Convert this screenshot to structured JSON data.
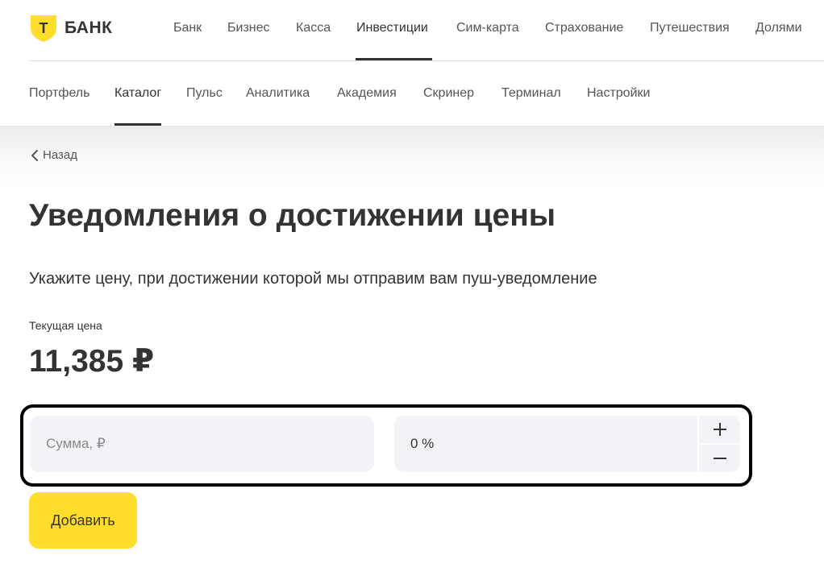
{
  "logo": {
    "text": "БАНК",
    "letter": "T",
    "color": "#ffdd2d"
  },
  "top_nav": {
    "items": [
      "Банк",
      "Бизнес",
      "Касса",
      "Инвестиции",
      "Сим-карта",
      "Страхование",
      "Путешествия",
      "Долями"
    ],
    "active": "Инвестиции"
  },
  "sub_nav": {
    "items": [
      "Портфель",
      "Каталог",
      "Пульс",
      "Аналитика",
      "Академия",
      "Скринер",
      "Терминал",
      "Настройки"
    ],
    "active": "Каталог"
  },
  "back_label": "Назад",
  "page_title": "Уведомления о достижении цены",
  "subtitle": "Укажите цену, при достижении которой мы отправим вам пуш-уведомление",
  "current_price": {
    "label": "Текущая цена",
    "value": "11,385 ₽"
  },
  "form": {
    "sum_placeholder": "Сумма, ₽",
    "sum_value": "",
    "percent_value": "0 %",
    "plus_icon": "plus-icon",
    "minus_icon": "minus-icon"
  },
  "add_button_label": "Добавить",
  "colors": {
    "accent": "#ffdd2d",
    "field_bg": "#f2f3f6",
    "text": "#333333"
  }
}
